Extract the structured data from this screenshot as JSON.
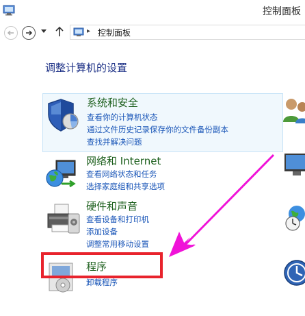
{
  "window": {
    "title": "控制面板",
    "title_icon": "control-panel-icon"
  },
  "address_bar": {
    "back_icon": "back-arrow-icon",
    "forward_icon": "forward-arrow-icon",
    "up_icon": "up-arrow-icon",
    "location_icon": "control-panel-icon",
    "separator": "▸",
    "location": "控制面板"
  },
  "main": {
    "heading": "调整计算机的设置",
    "categories": [
      {
        "title": "系统和安全",
        "icon": "shield-icon",
        "links": [
          "查看你的计算机状态",
          "通过文件历史记录保存你的文件备份副本",
          "查找并解决问题"
        ]
      },
      {
        "title": "网络和 Internet",
        "icon": "network-globe-icon",
        "links": [
          "查看网络状态和任务",
          "选择家庭组和共享选项"
        ]
      },
      {
        "title": "硬件和声音",
        "icon": "printer-icon",
        "links": [
          "查看设备和打印机",
          "添加设备",
          "调整常用移动设置"
        ]
      },
      {
        "title": "程序",
        "icon": "programs-icon",
        "links": [
          "卸载程序"
        ]
      }
    ],
    "right_column_icons": [
      "user-accounts-icon",
      "appearance-icon",
      "clock-globe-icon",
      "ease-of-access-icon"
    ]
  },
  "annotation": {
    "box_color": "#e8232c",
    "arrow_color": "#f012d8"
  }
}
